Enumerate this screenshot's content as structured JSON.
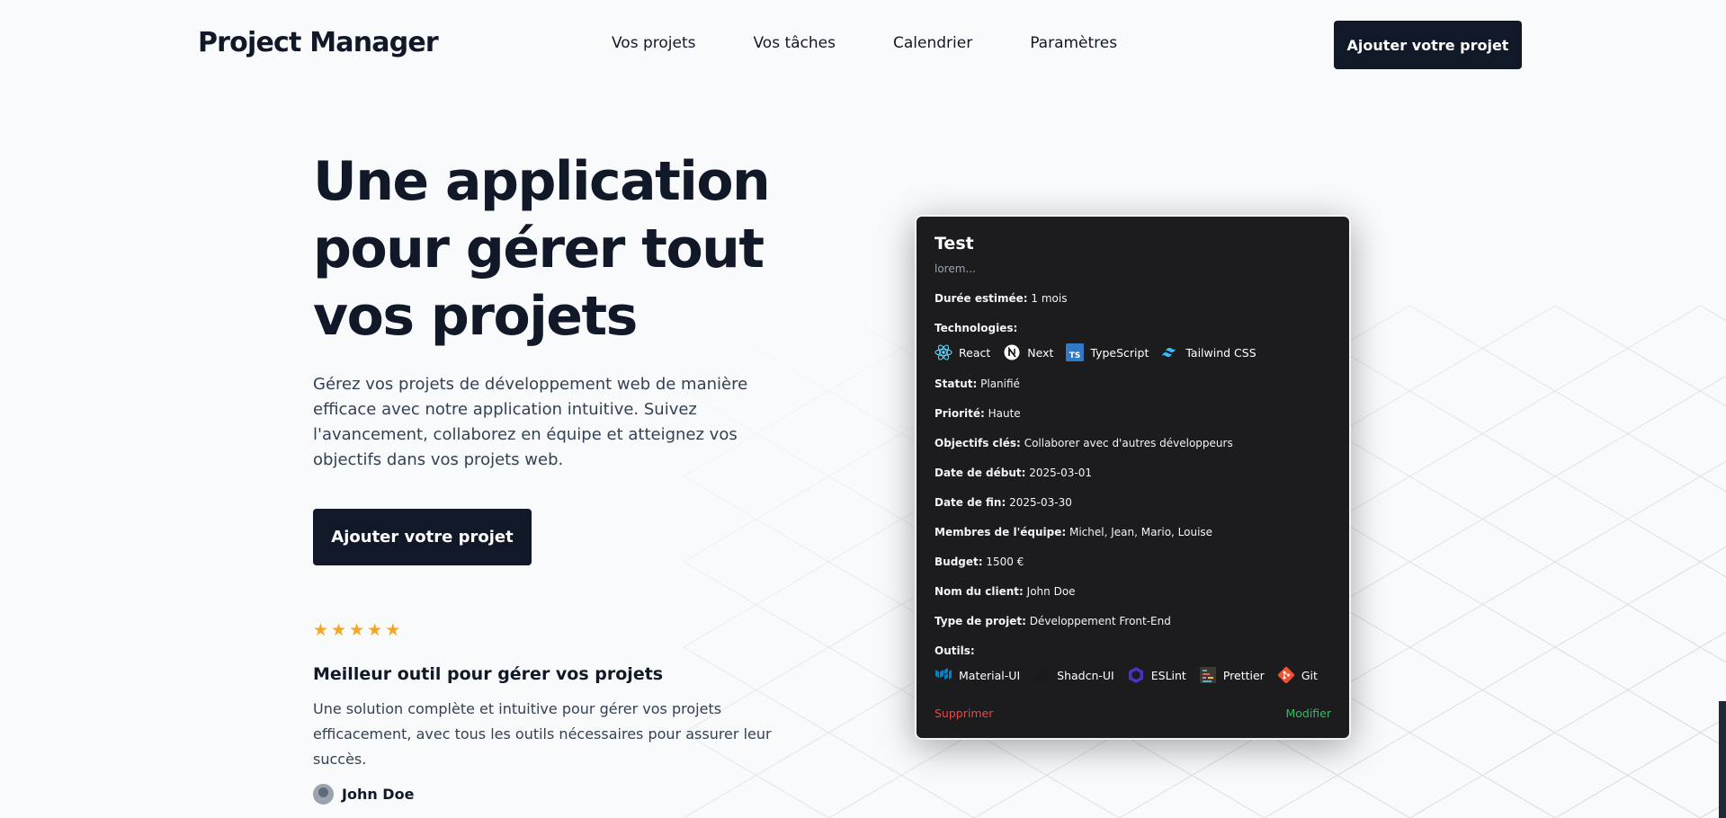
{
  "header": {
    "logo": "Project Manager",
    "nav": [
      "Vos projets",
      "Vos tâches",
      "Calendrier",
      "Paramètres"
    ],
    "cta": "Ajouter votre projet"
  },
  "hero": {
    "title_lines": [
      "Une application",
      "pour gérer tout",
      "vos projets"
    ],
    "description": "Gérez vos projets de développement web de manière efficace avec notre application intuitive. Suivez l'avancement, collaborez en équipe et atteignez vos objectifs dans vos projets web.",
    "cta": "Ajouter votre projet"
  },
  "review": {
    "rating": 5,
    "title": "Meilleur outil pour gérer vos projets",
    "text": "Une solution complète et intuitive pour gérer vos projets efficacement, avec tous les outils nécessaires pour assurer leur succès.",
    "author": "John Doe"
  },
  "card": {
    "title": "Test",
    "description": "lorem...",
    "duration_label": "Durée estimée:",
    "duration": "1 mois",
    "technologies_label": "Technologies:",
    "technologies": [
      {
        "name": "React",
        "icon": "react-icon"
      },
      {
        "name": "Next",
        "icon": "nextjs-icon"
      },
      {
        "name": "TypeScript",
        "icon": "typescript-icon"
      },
      {
        "name": "Tailwind CSS",
        "icon": "tailwind-icon"
      }
    ],
    "status_label": "Statut:",
    "status": "Planifié",
    "priority_label": "Priorité:",
    "priority": "Haute",
    "objectives_label": "Objectifs clés:",
    "objectives": "Collaborer avec d'autres développeurs",
    "start_label": "Date de début:",
    "start": "2025-03-01",
    "end_label": "Date de fin:",
    "end": "2025-03-30",
    "team_label": "Membres de l'équipe:",
    "team": "Michel, Jean, Mario, Louise",
    "budget_label": "Budget:",
    "budget": "1500 €",
    "client_label": "Nom du client:",
    "client": "John Doe",
    "type_label": "Type de projet:",
    "type": "Développement Front-End",
    "tools_label": "Outils:",
    "tools": [
      {
        "name": "Material-UI",
        "icon": "material-ui-icon"
      },
      {
        "name": "Shadcn-UI",
        "icon": "shadcn-icon"
      },
      {
        "name": "ESLint",
        "icon": "eslint-icon"
      },
      {
        "name": "Prettier",
        "icon": "prettier-icon"
      },
      {
        "name": "Git",
        "icon": "git-icon"
      }
    ],
    "delete": "Supprimer",
    "edit": "Modifier"
  },
  "colors": {
    "primary": "#111827",
    "star": "#f5a623",
    "delete": "#ef4444",
    "edit": "#22c55e",
    "card_bg": "#1c1c1e"
  }
}
